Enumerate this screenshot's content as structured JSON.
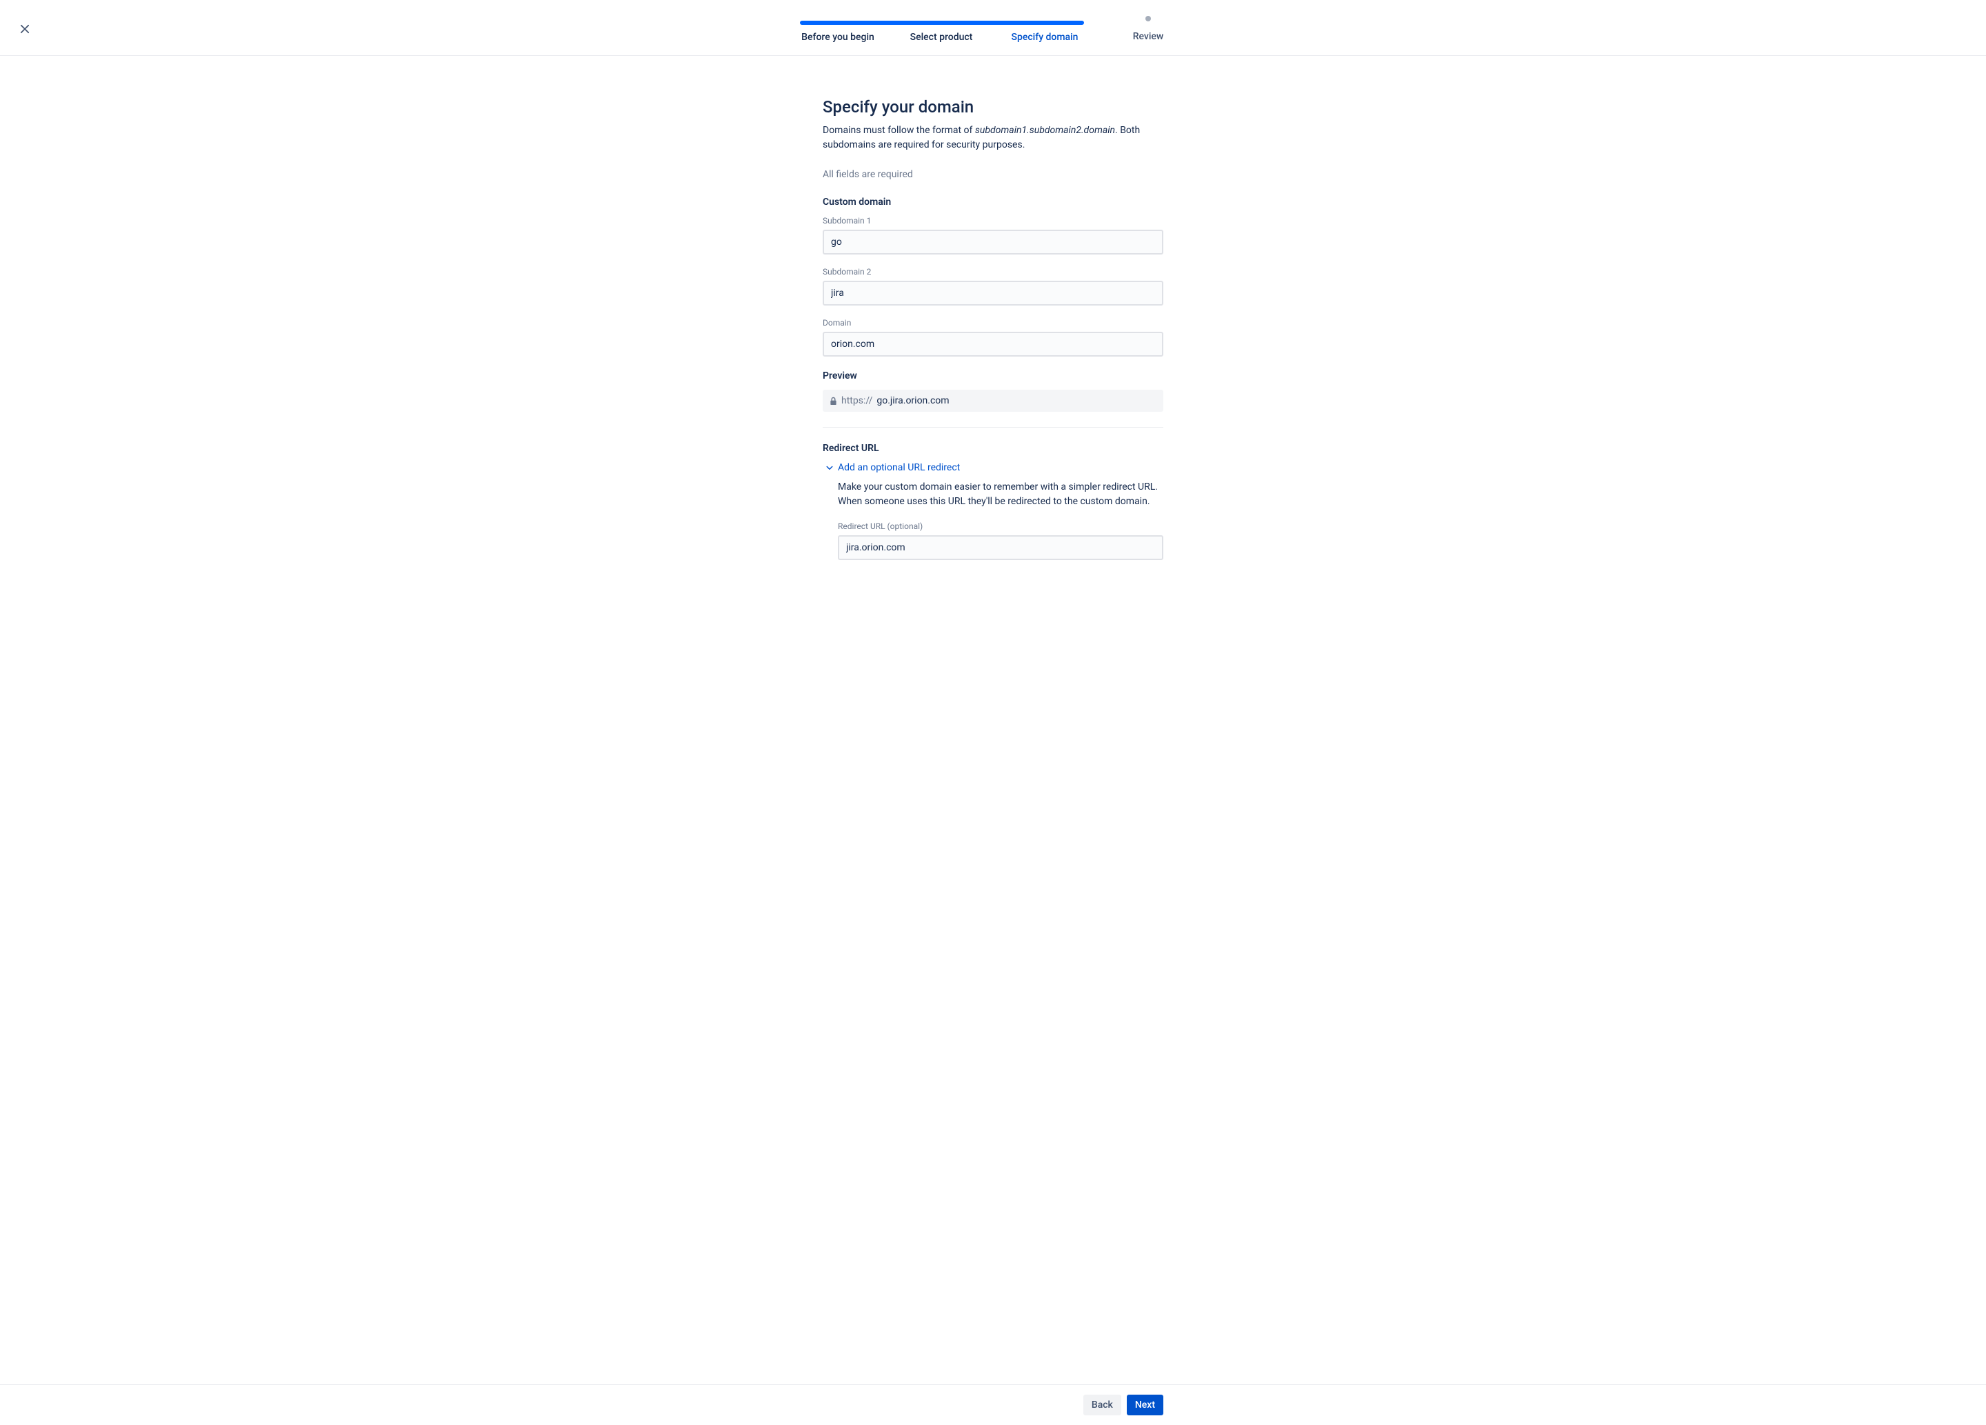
{
  "stepper": {
    "steps": [
      {
        "label": "Before you begin",
        "state": "done"
      },
      {
        "label": "Select product",
        "state": "done"
      },
      {
        "label": "Specify domain",
        "state": "active"
      },
      {
        "label": "Review",
        "state": "pending"
      }
    ]
  },
  "page": {
    "title": "Specify your domain",
    "description_prefix": "Domains must follow the format of ",
    "description_format": "subdomain1.subdomain2.domain",
    "description_suffix": ". Both subdomains are required for security purposes.",
    "required_note": "All fields are required"
  },
  "custom_domain": {
    "section_label": "Custom domain",
    "subdomain1_label": "Subdomain 1",
    "subdomain1_value": "go",
    "subdomain2_label": "Subdomain 2",
    "subdomain2_value": "jira",
    "domain_label": "Domain",
    "domain_value": "orion.com"
  },
  "preview": {
    "section_label": "Preview",
    "prefix": "https://",
    "domain": "go.jira.orion.com"
  },
  "redirect": {
    "section_label": "Redirect URL",
    "expand_label": "Add an optional URL redirect",
    "description": "Make your custom domain easier to remember with a simpler redirect URL. When someone uses this URL they'll be redirected to the custom domain.",
    "field_label": "Redirect URL (optional)",
    "field_value": "jira.orion.com"
  },
  "footer": {
    "back_label": "Back",
    "next_label": "Next"
  }
}
